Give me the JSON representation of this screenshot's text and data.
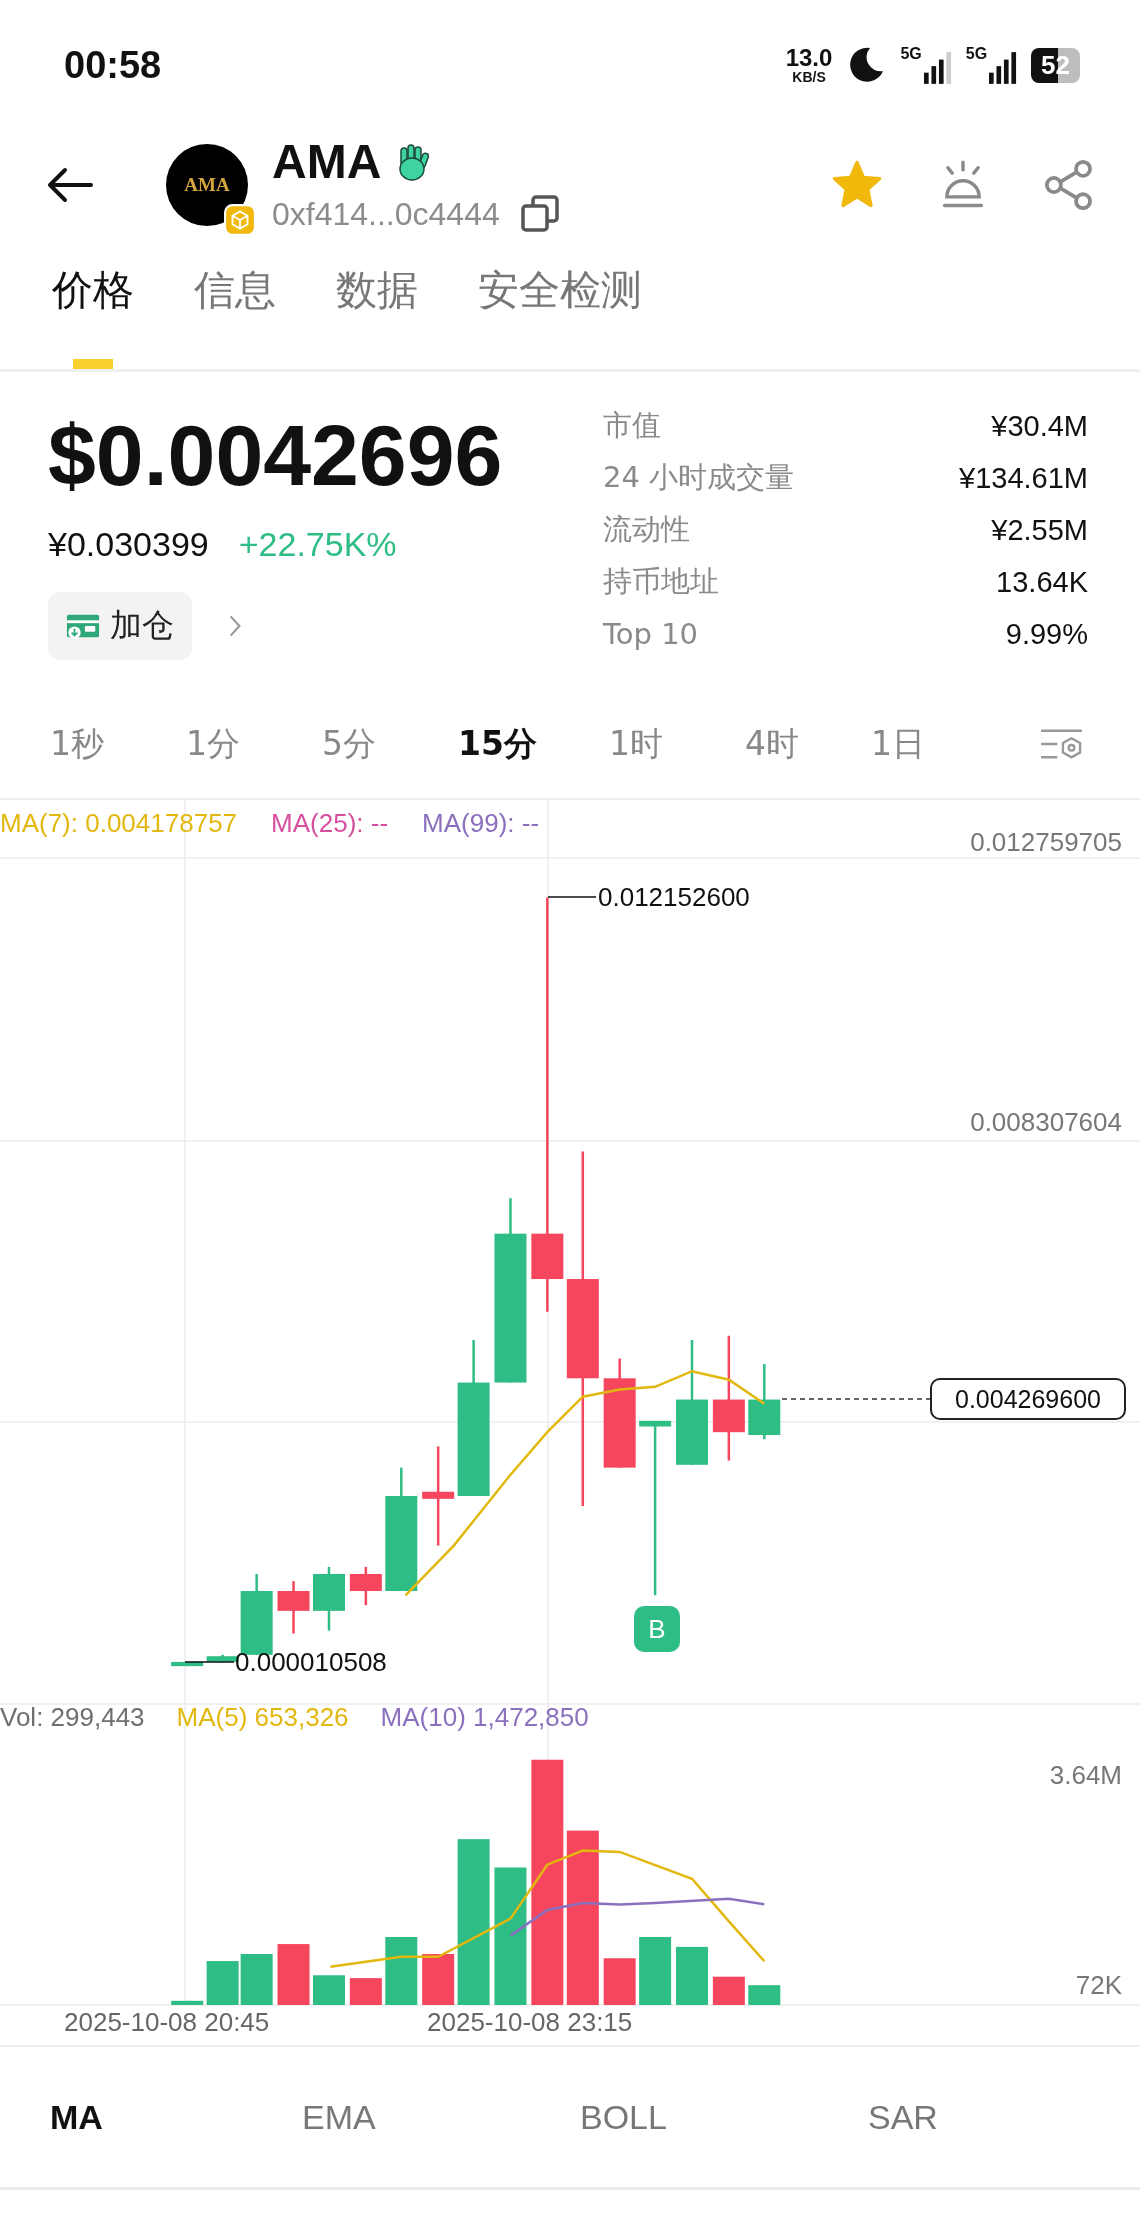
{
  "status_bar": {
    "time": "00:58",
    "net_speed": "13.0",
    "net_unit": "KB/S",
    "signals": [
      {
        "label": "5G"
      },
      {
        "label": "5G"
      }
    ],
    "battery": "52"
  },
  "token": {
    "logo": "AMA",
    "name": "AMA",
    "address": "0xf414...0c4444",
    "favorited": true
  },
  "tabs": [
    {
      "label": "价格",
      "selected": true
    },
    {
      "label": "信息",
      "selected": false
    },
    {
      "label": "数据",
      "selected": false
    },
    {
      "label": "安全检测",
      "selected": false
    }
  ],
  "price": {
    "usd": "$0.0042696",
    "cny": "¥0.030399",
    "change": "+22.75K%",
    "add_button": "加仓"
  },
  "stats": [
    {
      "label": "市值",
      "value": "¥30.4M"
    },
    {
      "label": "24 小时成交量",
      "value": "¥134.61M"
    },
    {
      "label": "流动性",
      "value": "¥2.55M"
    },
    {
      "label": "持币地址",
      "value": "13.64K"
    },
    {
      "label": "Top 10",
      "value": "9.99%"
    }
  ],
  "intervals": [
    {
      "label": "1秒",
      "selected": false
    },
    {
      "label": "1分",
      "selected": false
    },
    {
      "label": "5分",
      "selected": false
    },
    {
      "label": "15分",
      "selected": true
    },
    {
      "label": "1时",
      "selected": false
    },
    {
      "label": "4时",
      "selected": false
    },
    {
      "label": "1日",
      "selected": false
    }
  ],
  "chart": {
    "ma_legend": [
      {
        "label": "MA(7): 0.004178757",
        "color": "#e2b70e"
      },
      {
        "label": "MA(25): --",
        "color": "#d64f9e"
      },
      {
        "label": "MA(99): --",
        "color": "#8a70bd"
      }
    ],
    "price_axis": [
      "0.012759705",
      "0.008307604"
    ],
    "current_price": "0.004269600",
    "high_label": "0.012152600",
    "low_label": "0.000010508",
    "trade_marker": "B",
    "volume_legend": [
      {
        "label": "Vol: 299,443",
        "color": "#6f6f6f"
      },
      {
        "label": "MA(5) 653,326",
        "color": "#e2b70e"
      },
      {
        "label": "MA(10) 1,472,850",
        "color": "#8a70bd"
      }
    ],
    "volume_axis": [
      "3.64M",
      "72K"
    ],
    "time_axis": [
      "2025-10-08 20:45",
      "2025-10-08 23:15"
    ]
  },
  "indicators": [
    {
      "label": "MA",
      "selected": true
    },
    {
      "label": "EMA",
      "selected": false
    },
    {
      "label": "BOLL",
      "selected": false
    },
    {
      "label": "SAR",
      "selected": false
    }
  ]
}
